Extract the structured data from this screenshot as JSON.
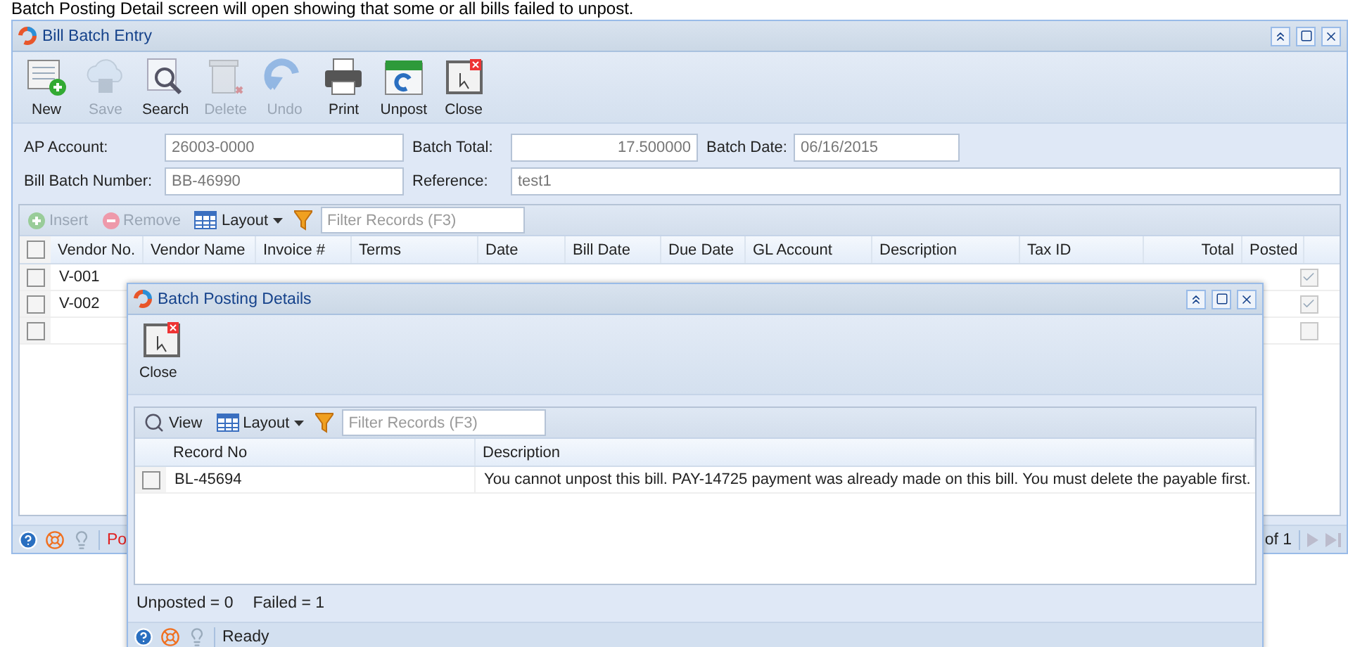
{
  "caption": "Batch Posting Detail screen will open showing that some or all bills failed to unpost.",
  "main_window": {
    "title": "Bill Batch Entry",
    "toolbar": [
      {
        "label": "New",
        "kind": "new",
        "disabled": false
      },
      {
        "label": "Save",
        "kind": "save",
        "disabled": true
      },
      {
        "label": "Search",
        "kind": "search",
        "disabled": false
      },
      {
        "label": "Delete",
        "kind": "delete",
        "disabled": true
      },
      {
        "label": "Undo",
        "kind": "undo",
        "disabled": true
      },
      {
        "label": "Print",
        "kind": "print",
        "disabled": false
      },
      {
        "label": "Unpost",
        "kind": "unpost",
        "disabled": false
      },
      {
        "label": "Close",
        "kind": "close",
        "disabled": false
      }
    ],
    "field_rows": [
      [
        {
          "label": "AP Account:",
          "value": "26003-0000",
          "kind": "text"
        },
        {
          "label": "Batch Total:",
          "value": "17.500000",
          "kind": "number"
        },
        {
          "label": "Batch Date:",
          "value": "06/16/2015",
          "kind": "text"
        }
      ],
      [
        {
          "label": "Bill Batch Number:",
          "value": "BB-46990",
          "kind": "text"
        },
        {
          "label": "Reference:",
          "value": "test1",
          "kind": "text"
        }
      ]
    ],
    "grid": {
      "toolbar": [
        {
          "label": "Insert",
          "kind": "insert",
          "disabled": true
        },
        {
          "label": "Remove",
          "kind": "remove",
          "disabled": true
        },
        {
          "label": "Layout",
          "kind": "layout",
          "disabled": false
        }
      ],
      "filter_placeholder": "Filter Records (F3)",
      "all_checked": false,
      "columns": [
        "Vendor No.",
        "Vendor Name",
        "Invoice #",
        "Terms",
        "Date",
        "Bill Date",
        "Due Date",
        "GL Account",
        "Description",
        "Tax ID",
        "Total",
        "Posted"
      ],
      "rows": [
        {
          "checked": false,
          "vendor_no": "V-001",
          "posted": true
        },
        {
          "checked": false,
          "vendor_no": "V-002",
          "posted": true
        },
        {
          "checked": false,
          "vendor_no": "",
          "posted": false
        }
      ]
    },
    "status_bar": {
      "message": "Po",
      "pager": "of 1"
    }
  },
  "dialog": {
    "title": "Batch Posting Details",
    "toolbar": [
      {
        "label": "Close",
        "kind": "close"
      }
    ],
    "grid": {
      "toolbar": [
        {
          "label": "View",
          "kind": "view"
        },
        {
          "label": "Layout",
          "kind": "layout"
        }
      ],
      "filter_placeholder": "Filter Records (F3)",
      "columns": [
        "Record No",
        "Description"
      ],
      "rows": [
        {
          "checked": false,
          "record_no": "BL-45694",
          "description": "You cannot unpost this bill. PAY-14725 payment was already made on this bill. You must delete the payable first."
        }
      ]
    },
    "summary": [
      {
        "label": "Unposted = 0"
      },
      {
        "label": "Failed = 1"
      }
    ],
    "status_bar": {
      "message": "Ready"
    }
  }
}
